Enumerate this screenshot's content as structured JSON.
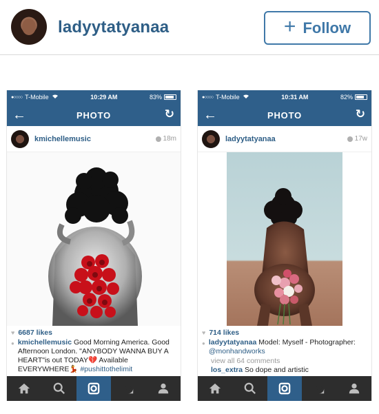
{
  "profile": {
    "username": "ladyytatyanaa",
    "follow_label": "Follow"
  },
  "panels": [
    {
      "status": {
        "carrier": "T-Mobile",
        "time": "10:29 AM",
        "battery": "83%",
        "battery_level": 0.83
      },
      "nav_title": "PHOTO",
      "post": {
        "user": "kmichellemusic",
        "time": "18m",
        "likes": "6687 likes",
        "caption_user": "kmichellemusic",
        "caption_text": " Good Morning America. Good Afternoon London. \"ANYBODY WANNA BUY A HEART\"is out TODAY💔 Available EVERYWHERE💃",
        "caption_tag": " #pushittothelimit"
      }
    },
    {
      "status": {
        "carrier": "T-Mobile",
        "time": "10:31 AM",
        "battery": "82%",
        "battery_level": 0.82
      },
      "nav_title": "PHOTO",
      "post": {
        "user": "ladyytatyanaa",
        "time": "17w",
        "likes": "714 likes",
        "caption_user": "ladyytatyanaa",
        "caption_text": " Model: Myself - Photographer:",
        "caption_mention": " @monhandworks",
        "view_comments": "view all 64 comments",
        "comment_user": "los_extra",
        "comment_text": " So dope and artistic"
      }
    }
  ],
  "icons": {
    "back": "back-arrow-icon",
    "refresh": "refresh-icon",
    "tabs": [
      "home-icon",
      "search-icon",
      "camera-icon",
      "activity-icon",
      "profile-icon"
    ]
  },
  "colors": {
    "brand_blue": "#2f5f8a",
    "link_blue": "#2e5e86",
    "tabbar": "#2d2d2d",
    "rose_red": "#c8101a",
    "rose_pink": "#e8a0b0"
  }
}
